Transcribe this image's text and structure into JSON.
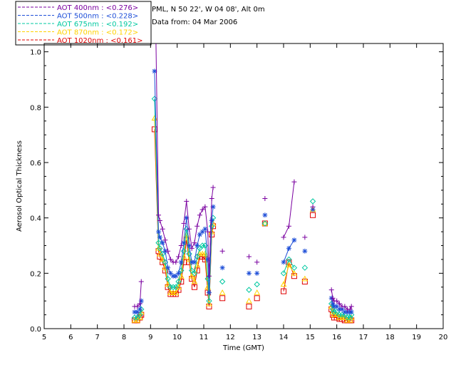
{
  "chart_data": {
    "type": "line",
    "title": "",
    "xlabel": "Time (GMT)",
    "ylabel": "Aerosol Optical Thickness",
    "xlim": [
      5,
      20
    ],
    "ylim": [
      0,
      1.03
    ],
    "x_ticks": [
      5,
      6,
      7,
      8,
      9,
      10,
      11,
      12,
      13,
      14,
      15,
      16,
      17,
      18,
      19,
      20
    ],
    "y_ticks": [
      0.0,
      0.2,
      0.4,
      0.6,
      0.8,
      1.0
    ],
    "y_tick_labels": [
      "0.0",
      "0.2",
      "0.4",
      "0.6",
      "0.8",
      "1.0"
    ],
    "grid": false,
    "legend_position": "top-left, outside plot",
    "info_lines": [
      "PML, N 50 22', W 04 08', Alt 0m",
      "Data from: 04 Mar 2006"
    ],
    "series": [
      {
        "name": "AOT  400nm : <0.276>",
        "color": "#7a00a0",
        "marker": "plus",
        "segments": [
          [
            [
              8.4,
              0.08
            ],
            [
              8.5,
              0.08
            ],
            [
              8.6,
              0.09
            ],
            [
              8.65,
              0.17
            ]
          ],
          [
            [
              9.2,
              1.05
            ],
            [
              9.3,
              0.41
            ],
            [
              9.35,
              0.39
            ],
            [
              9.45,
              0.36
            ],
            [
              9.55,
              0.32
            ],
            [
              9.65,
              0.28
            ],
            [
              9.75,
              0.25
            ],
            [
              9.85,
              0.24
            ],
            [
              9.95,
              0.24
            ],
            [
              10.05,
              0.26
            ],
            [
              10.15,
              0.3
            ],
            [
              10.25,
              0.38
            ],
            [
              10.35,
              0.46
            ],
            [
              10.45,
              0.36
            ],
            [
              10.55,
              0.29
            ],
            [
              10.65,
              0.31
            ],
            [
              10.75,
              0.37
            ],
            [
              10.85,
              0.41
            ],
            [
              10.95,
              0.43
            ],
            [
              11.05,
              0.44
            ],
            [
              11.15,
              0.35
            ],
            [
              11.2,
              0.19
            ],
            [
              11.3,
              0.47
            ],
            [
              11.35,
              0.51
            ]
          ],
          [
            [
              14.0,
              0.33
            ],
            [
              14.2,
              0.37
            ],
            [
              14.4,
              0.53
            ]
          ],
          [
            [
              15.8,
              0.14
            ],
            [
              15.85,
              0.11
            ],
            [
              15.9,
              0.1
            ],
            [
              16.0,
              0.1
            ],
            [
              16.1,
              0.09
            ],
            [
              16.2,
              0.08
            ],
            [
              16.3,
              0.08
            ],
            [
              16.4,
              0.07
            ],
            [
              16.5,
              0.07
            ],
            [
              16.55,
              0.08
            ]
          ]
        ],
        "isolated": [
          [
            11.7,
            0.28
          ],
          [
            12.7,
            0.26
          ],
          [
            13.0,
            0.24
          ],
          [
            13.3,
            0.47
          ],
          [
            14.8,
            0.33
          ],
          [
            15.1,
            0.44
          ]
        ]
      },
      {
        "name": "AOT  500nm : <0.228>",
        "color": "#1f4fd8",
        "marker": "asterisk",
        "segments": [
          [
            [
              8.4,
              0.06
            ],
            [
              8.5,
              0.06
            ],
            [
              8.6,
              0.07
            ],
            [
              8.65,
              0.1
            ]
          ],
          [
            [
              9.15,
              0.93
            ],
            [
              9.3,
              0.35
            ],
            [
              9.35,
              0.33
            ],
            [
              9.45,
              0.31
            ],
            [
              9.55,
              0.28
            ],
            [
              9.65,
              0.22
            ],
            [
              9.75,
              0.2
            ],
            [
              9.85,
              0.19
            ],
            [
              9.95,
              0.19
            ],
            [
              10.05,
              0.2
            ],
            [
              10.15,
              0.24
            ],
            [
              10.25,
              0.31
            ],
            [
              10.35,
              0.4
            ],
            [
              10.45,
              0.3
            ],
            [
              10.55,
              0.24
            ],
            [
              10.65,
              0.24
            ],
            [
              10.75,
              0.3
            ],
            [
              10.85,
              0.34
            ],
            [
              10.95,
              0.35
            ],
            [
              11.05,
              0.36
            ],
            [
              11.15,
              0.25
            ],
            [
              11.2,
              0.13
            ],
            [
              11.3,
              0.39
            ],
            [
              11.35,
              0.44
            ]
          ],
          [
            [
              14.0,
              0.24
            ],
            [
              14.2,
              0.29
            ],
            [
              14.4,
              0.32
            ]
          ],
          [
            [
              15.8,
              0.11
            ],
            [
              15.85,
              0.09
            ],
            [
              15.9,
              0.08
            ],
            [
              16.0,
              0.08
            ],
            [
              16.1,
              0.07
            ],
            [
              16.2,
              0.07
            ],
            [
              16.3,
              0.06
            ],
            [
              16.4,
              0.06
            ],
            [
              16.5,
              0.06
            ],
            [
              16.55,
              0.06
            ]
          ]
        ],
        "isolated": [
          [
            11.7,
            0.22
          ],
          [
            12.7,
            0.2
          ],
          [
            13.0,
            0.2
          ],
          [
            13.3,
            0.41
          ],
          [
            14.8,
            0.28
          ],
          [
            15.1,
            0.43
          ]
        ]
      },
      {
        "name": "AOT  675nm : <0.192>",
        "color": "#00c8a0",
        "marker": "diamond",
        "segments": [
          [
            [
              8.4,
              0.04
            ],
            [
              8.5,
              0.04
            ],
            [
              8.6,
              0.05
            ],
            [
              8.65,
              0.07
            ]
          ],
          [
            [
              9.15,
              0.83
            ],
            [
              9.3,
              0.31
            ],
            [
              9.35,
              0.29
            ],
            [
              9.45,
              0.27
            ],
            [
              9.55,
              0.24
            ],
            [
              9.65,
              0.18
            ],
            [
              9.75,
              0.15
            ],
            [
              9.85,
              0.15
            ],
            [
              9.95,
              0.15
            ],
            [
              10.05,
              0.17
            ],
            [
              10.15,
              0.21
            ],
            [
              10.25,
              0.28
            ],
            [
              10.35,
              0.36
            ],
            [
              10.45,
              0.27
            ],
            [
              10.55,
              0.21
            ],
            [
              10.65,
              0.2
            ],
            [
              10.75,
              0.26
            ],
            [
              10.85,
              0.29
            ],
            [
              10.95,
              0.3
            ],
            [
              11.05,
              0.3
            ],
            [
              11.15,
              0.18
            ],
            [
              11.2,
              0.1
            ],
            [
              11.3,
              0.37
            ],
            [
              11.35,
              0.4
            ]
          ],
          [
            [
              14.0,
              0.2
            ],
            [
              14.2,
              0.25
            ],
            [
              14.4,
              0.22
            ]
          ],
          [
            [
              15.8,
              0.09
            ],
            [
              15.85,
              0.07
            ],
            [
              15.9,
              0.06
            ],
            [
              16.0,
              0.06
            ],
            [
              16.1,
              0.05
            ],
            [
              16.2,
              0.05
            ],
            [
              16.3,
              0.05
            ],
            [
              16.4,
              0.04
            ],
            [
              16.5,
              0.04
            ],
            [
              16.55,
              0.05
            ]
          ]
        ],
        "isolated": [
          [
            11.7,
            0.17
          ],
          [
            12.7,
            0.14
          ],
          [
            13.0,
            0.16
          ],
          [
            13.3,
            0.38
          ],
          [
            14.8,
            0.22
          ],
          [
            15.1,
            0.46
          ]
        ]
      },
      {
        "name": "AOT  870nm : <0.172>",
        "color": "#ffd200",
        "marker": "triangle",
        "segments": [
          [
            [
              8.4,
              0.03
            ],
            [
              8.5,
              0.03
            ],
            [
              8.6,
              0.04
            ],
            [
              8.65,
              0.06
            ]
          ],
          [
            [
              9.15,
              0.76
            ],
            [
              9.3,
              0.29
            ],
            [
              9.35,
              0.27
            ],
            [
              9.45,
              0.25
            ],
            [
              9.55,
              0.22
            ],
            [
              9.65,
              0.16
            ],
            [
              9.75,
              0.13
            ],
            [
              9.85,
              0.13
            ],
            [
              9.95,
              0.13
            ],
            [
              10.05,
              0.15
            ],
            [
              10.15,
              0.19
            ],
            [
              10.25,
              0.26
            ],
            [
              10.35,
              0.34
            ],
            [
              10.45,
              0.25
            ],
            [
              10.55,
              0.19
            ],
            [
              10.65,
              0.17
            ],
            [
              10.75,
              0.23
            ],
            [
              10.85,
              0.27
            ],
            [
              10.95,
              0.27
            ],
            [
              11.05,
              0.27
            ],
            [
              11.15,
              0.15
            ],
            [
              11.2,
              0.09
            ],
            [
              11.3,
              0.35
            ],
            [
              11.35,
              0.38
            ]
          ],
          [
            [
              14.0,
              0.16
            ],
            [
              14.2,
              0.23
            ],
            [
              14.4,
              0.2
            ]
          ],
          [
            [
              15.8,
              0.08
            ],
            [
              15.85,
              0.06
            ],
            [
              15.9,
              0.05
            ],
            [
              16.0,
              0.05
            ],
            [
              16.1,
              0.04
            ],
            [
              16.2,
              0.04
            ],
            [
              16.3,
              0.04
            ],
            [
              16.4,
              0.03
            ],
            [
              16.5,
              0.03
            ],
            [
              16.55,
              0.04
            ]
          ]
        ],
        "isolated": [
          [
            11.7,
            0.13
          ],
          [
            12.7,
            0.1
          ],
          [
            13.0,
            0.13
          ],
          [
            13.3,
            0.38
          ],
          [
            14.8,
            0.18
          ],
          [
            15.1,
            0.43
          ]
        ]
      },
      {
        "name": "AOT 1020nm : <0.161>",
        "color": "#e00000",
        "marker": "square",
        "segments": [
          [
            [
              8.4,
              0.03
            ],
            [
              8.5,
              0.03
            ],
            [
              8.6,
              0.04
            ],
            [
              8.65,
              0.05
            ]
          ],
          [
            [
              9.15,
              0.72
            ],
            [
              9.3,
              0.28
            ],
            [
              9.35,
              0.26
            ],
            [
              9.45,
              0.24
            ],
            [
              9.55,
              0.21
            ],
            [
              9.65,
              0.15
            ],
            [
              9.75,
              0.125
            ],
            [
              9.85,
              0.125
            ],
            [
              9.95,
              0.125
            ],
            [
              10.05,
              0.14
            ],
            [
              10.15,
              0.17
            ],
            [
              10.25,
              0.24
            ],
            [
              10.35,
              0.32
            ],
            [
              10.45,
              0.24
            ],
            [
              10.55,
              0.18
            ],
            [
              10.65,
              0.15
            ],
            [
              10.75,
              0.21
            ],
            [
              10.85,
              0.26
            ],
            [
              10.95,
              0.26
            ],
            [
              11.05,
              0.25
            ],
            [
              11.15,
              0.13
            ],
            [
              11.2,
              0.08
            ],
            [
              11.3,
              0.34
            ],
            [
              11.35,
              0.37
            ]
          ],
          [
            [
              14.0,
              0.135
            ],
            [
              14.2,
              0.24
            ],
            [
              14.4,
              0.19
            ]
          ],
          [
            [
              15.8,
              0.07
            ],
            [
              15.85,
              0.05
            ],
            [
              15.9,
              0.04
            ],
            [
              16.0,
              0.04
            ],
            [
              16.1,
              0.035
            ],
            [
              16.2,
              0.035
            ],
            [
              16.3,
              0.03
            ],
            [
              16.4,
              0.03
            ],
            [
              16.5,
              0.03
            ],
            [
              16.55,
              0.03
            ]
          ]
        ],
        "isolated": [
          [
            11.7,
            0.11
          ],
          [
            12.7,
            0.08
          ],
          [
            13.0,
            0.11
          ],
          [
            13.3,
            0.38
          ],
          [
            14.8,
            0.17
          ],
          [
            15.1,
            0.41
          ]
        ]
      }
    ]
  }
}
